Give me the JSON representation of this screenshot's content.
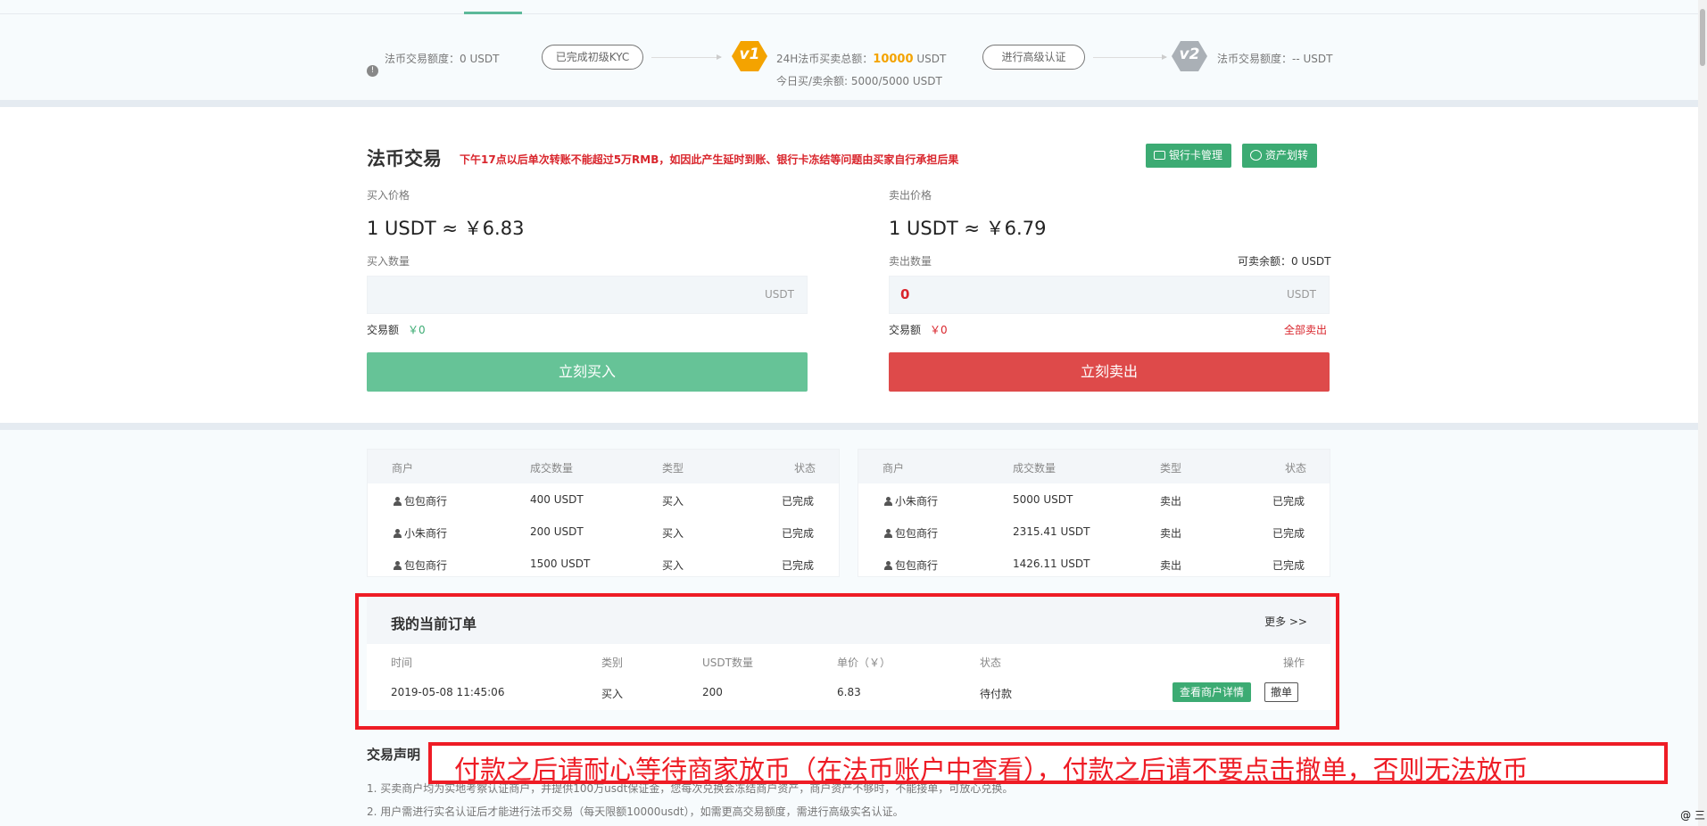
{
  "kyc": {
    "current_limit": "法币交易额度：0 USDT",
    "step1_label": "已完成初级KYC",
    "v1_badge": "v1",
    "v1_total_prefix": "24H法币买卖总额：",
    "v1_total_value": "10000",
    "v1_total_unit": "USDT",
    "v1_remaining": "今日买/卖余额: 5000/5000 USDT",
    "step2_label": "进行高级认证",
    "v2_badge": "v2",
    "v2_limit": "法币交易额度：-- USDT"
  },
  "trade": {
    "title": "法币交易",
    "notice": "下午17点以后单次转账不能超过5万RMB，如因此产生延时到账、银行卡冻结等问题由买家自行承担后果",
    "bank_button": "银行卡管理",
    "transfer_button": "资产划转",
    "buy": {
      "price_label": "买入价格",
      "price": "1 USDT ≈ ￥6.83",
      "qty_label": "买入数量",
      "qty_value": "",
      "unit": "USDT",
      "amount_label": "交易额",
      "amount_value": "￥0",
      "button": "立刻买入"
    },
    "sell": {
      "price_label": "卖出价格",
      "price": "1 USDT ≈ ￥6.79",
      "qty_label": "卖出数量",
      "available": "可卖余额：0 USDT",
      "qty_value": "0",
      "unit": "USDT",
      "amount_label": "交易额",
      "amount_value": "￥0",
      "sell_all": "全部卖出",
      "button": "立刻卖出"
    }
  },
  "buy_records": {
    "headers": [
      "商户",
      "成交数量",
      "类型",
      "状态"
    ],
    "rows": [
      {
        "merchant": "包包商行",
        "qty": "400 USDT",
        "type": "买入",
        "status": "已完成"
      },
      {
        "merchant": "小朱商行",
        "qty": "200 USDT",
        "type": "买入",
        "status": "已完成"
      },
      {
        "merchant": "包包商行",
        "qty": "1500 USDT",
        "type": "买入",
        "status": "已完成"
      }
    ]
  },
  "sell_records": {
    "headers": [
      "商户",
      "成交数量",
      "类型",
      "状态"
    ],
    "rows": [
      {
        "merchant": "小朱商行",
        "qty": "5000 USDT",
        "type": "卖出",
        "status": "已完成"
      },
      {
        "merchant": "包包商行",
        "qty": "2315.41 USDT",
        "type": "卖出",
        "status": "已完成"
      },
      {
        "merchant": "包包商行",
        "qty": "1426.11 USDT",
        "type": "卖出",
        "status": "已完成"
      }
    ]
  },
  "orders": {
    "title": "我的当前订单",
    "more": "更多 >>",
    "headers": [
      "时间",
      "类别",
      "USDT数量",
      "单价（￥）",
      "状态",
      "操作"
    ],
    "row": {
      "time": "2019-05-08 11:45:06",
      "type": "买入",
      "qty": "200",
      "price": "6.83",
      "status": "待付款",
      "detail_button": "查看商户详情",
      "cancel_button": "撤单"
    }
  },
  "declaration": {
    "title": "交易声明",
    "line1": "1. 买卖商户均为实地考察认证商户，并提供100万usdt保证金，您每次兑换会冻结商户资产，商户资产不够时，不能接单，可放心兑换。",
    "line2": "2. 用户需进行实名认证后才能进行法币交易（每天限额10000usdt），如需更高交易额度，需进行高级实名认证。"
  },
  "overlay_note": "付款之后请耐心等待商家放币（在法币账户中查看），付款之后请不要点击撤单，否则无法放币",
  "corner_icons": "@ 三",
  "colors": {
    "green": "#3cab73",
    "buy_button": "#66c397",
    "sell_button": "#de4a4a",
    "red": "#d9252c",
    "highlight": "#ee1c25",
    "gold": "#f4a300"
  }
}
